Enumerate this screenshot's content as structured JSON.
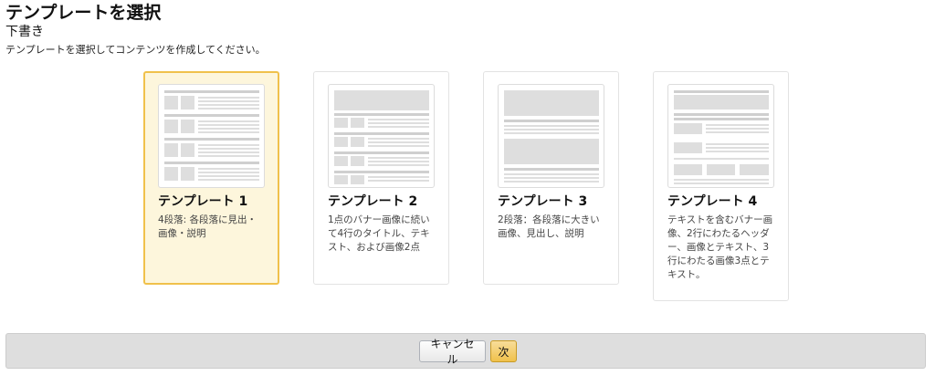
{
  "header": {
    "title": "テンプレートを選択",
    "subtitle": "下書き",
    "instruction": "テンプレートを選択してコンテンツを作成してください。"
  },
  "templates": [
    {
      "name": "テンプレート 1",
      "description": "4段落: 各段落に見出・画像・説明",
      "selected": true
    },
    {
      "name": "テンプレート 2",
      "description": "1点のバナー画像に続いて4行のタイトル、テキスト、および画像2点",
      "selected": false
    },
    {
      "name": "テンプレート 3",
      "description": "2段落：各段落に大きい画像、見出し、説明",
      "selected": false
    },
    {
      "name": "テンプレート 4",
      "description": "テキストを含むバナー画像、2行にわたるヘッダー、画像とテキスト、3行にわたる画像3点とテキスト。",
      "selected": false
    }
  ],
  "footer": {
    "cancel_label": "キャンセル",
    "next_label": "次"
  },
  "colors": {
    "selected_border": "#f0c14b",
    "selected_background": "#fdf6dc",
    "primary_button": "#f0c14b"
  }
}
